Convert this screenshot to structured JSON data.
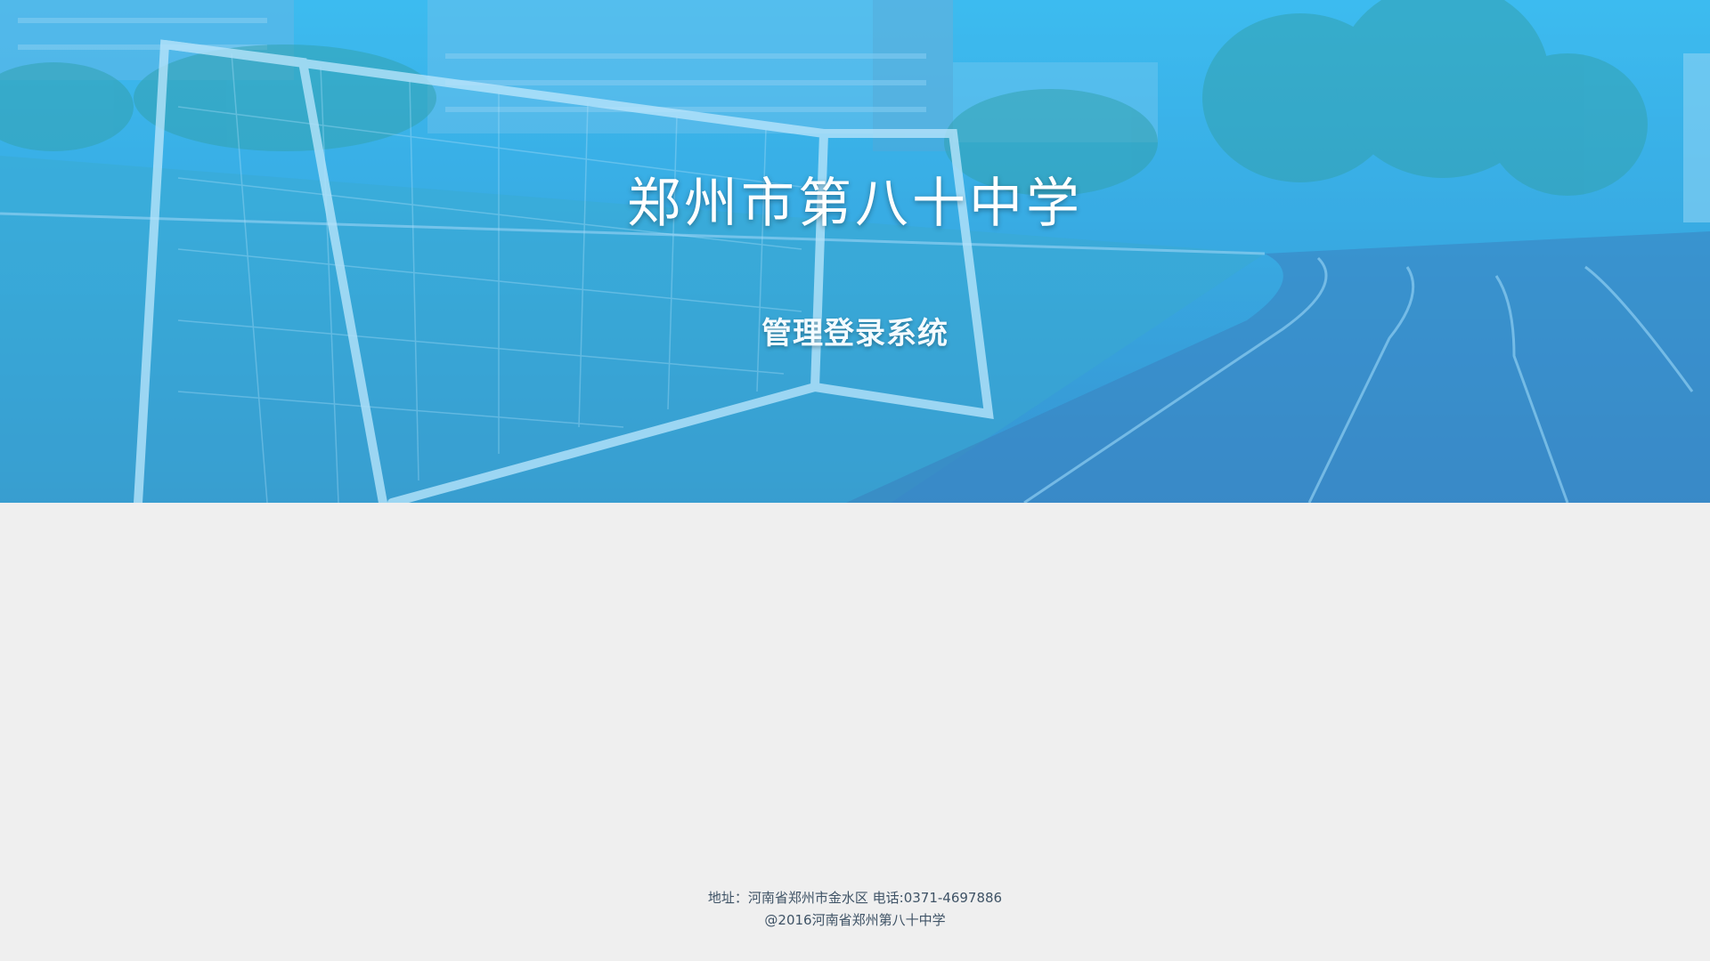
{
  "hero": {
    "title": "郑州市第八十中学",
    "subtitle": "管理登录系统"
  },
  "footer": {
    "address_line": "地址：河南省郑州市金水区 电话:0371-4697886",
    "copyright_line": "@2016河南省郑州第八十中学"
  },
  "colors": {
    "hero_overlay": "#3dbdf0",
    "page_background": "#efefef",
    "footer_text": "#3f5366"
  }
}
